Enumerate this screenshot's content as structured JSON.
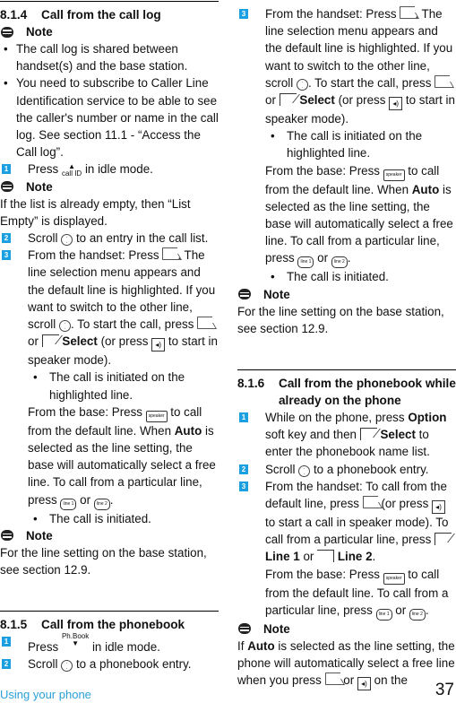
{
  "left_column": {
    "s814": {
      "number": "8.1.4",
      "title": "Call from the call log",
      "note_label": "Note",
      "bullets": [
        "The call log is shared between handset(s) and the base station.",
        "You need to subscribe to Caller Line Identification service to be able to see the caller's number or name in the call log. See section 11.1 - “Access the Call log”."
      ],
      "step1": {
        "num": "1",
        "pre": "Press",
        "icon_label": "call ID",
        "post": "in idle mode."
      },
      "note2_label": "Note",
      "note2_text": "If the list is already empty, then “List Empty” is displayed.",
      "step2": {
        "num": "2",
        "pre": "Scroll",
        "post": "to an entry in the call list."
      },
      "step3": {
        "num": "3",
        "t1": "From the handset: Press",
        "t2": ". The line selection menu appears and the default line is highlighted. If you want to switch to the other line, scroll",
        "t3": ". To start the call, press",
        "t4": "or",
        "select": "Select",
        "t5": "(or press",
        "t6": "to start in speaker mode).",
        "sub_bullet": "The call is initiated on the highlighted line.",
        "base1": "From the base: Press",
        "speaker_key": "speaker",
        "base2": "to call from the default line. When",
        "auto": "Auto",
        "base3": "is selected as the line setting, the base will automatically select a free line. To call from a particular line, press",
        "line1_key": "line 1",
        "or": "or",
        "line2_key": "line 2",
        "period": ".",
        "sub_bullet2": "The call is initiated."
      },
      "note3_label": "Note",
      "note3_text": "For the line setting on the base station, see section 12.9."
    },
    "s815": {
      "number": "8.1.5",
      "title": "Call from the phonebook",
      "step1": {
        "num": "1",
        "pre": "Press",
        "icon_label": "Ph.Book",
        "post": "in idle mode."
      },
      "step2": {
        "num": "2",
        "pre": "Scroll",
        "post": "to a phonebook entry."
      }
    }
  },
  "right_column": {
    "step3": {
      "num": "3",
      "t1": "From the handset: Press",
      "t2": ". The line selection menu appears and the default line is highlighted. If you want to switch to the other line, scroll",
      "t3": ". To start the call, press",
      "t4": "or",
      "select": "Select",
      "t5": "(or press",
      "t6": "to start in speaker mode).",
      "sub_bullet": "The call is initiated on the highlighted line.",
      "base1": "From the base: Press",
      "speaker_key": "speaker",
      "base2": "to call from the default line. When",
      "auto": "Auto",
      "base3": "is selected as the line setting, the base will automatically select a free line. To call from a particular line, press",
      "line1_key": "line 1",
      "or": "or",
      "line2_key": "line 2",
      "period": ".",
      "sub_bullet2": "The call is initiated."
    },
    "note_label": "Note",
    "note_text": "For the line setting on the base station, see section 12.9.",
    "s816": {
      "number": "8.1.6",
      "title": "Call from the phonebook while already on the phone",
      "step1": {
        "num": "1",
        "t1": "While on the phone, press",
        "option": "Option",
        "t2": "soft key and then",
        "select": "Select",
        "t3": "to enter the phonebook name list."
      },
      "step2": {
        "num": "2",
        "pre": "Scroll",
        "post": "to a phonebook entry."
      },
      "step3": {
        "num": "3",
        "t1": "From the handset: To call from the default line, press",
        "t2": "(or press",
        "t3": "to start a call in speaker mode). To call from a particular line, press",
        "line1": "Line 1",
        "or": "or",
        "line2": "Line 2",
        "period": ".",
        "base1": "From the base: Press",
        "speaker_key": "speaker",
        "base2": "to call from the default line. To call from a particular line, press",
        "line1_key": "line 1",
        "line2_key": "line 2"
      },
      "note_label": "Note",
      "note_pre": "If",
      "note_auto": "Auto",
      "note_t1": "is selected as the line setting, the phone will automatically select a free line when you press",
      "note_or": "or",
      "note_t2": "on the"
    }
  },
  "footer": {
    "section": "Using your phone",
    "page_number": "37"
  },
  "colors": {
    "accent": "#1aa0e0",
    "footer_text": "#2aa0d8"
  }
}
